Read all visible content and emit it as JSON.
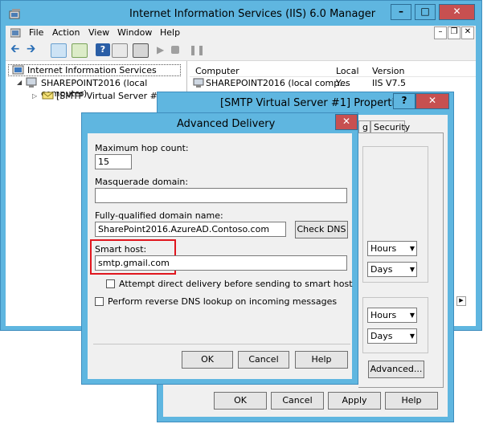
{
  "iis": {
    "title": "Internet Information Services (IIS) 6.0 Manager",
    "menu": [
      "File",
      "Action",
      "View",
      "Window",
      "Help"
    ],
    "tree": {
      "root": "Internet Information Services",
      "computer": "SHAREPOINT2016 (local computer)",
      "server": "[SMTP Virtual Server #1]"
    },
    "list": {
      "columns": [
        "Computer",
        "Local",
        "Version"
      ],
      "rows": [
        {
          "computer": "SHAREPOINT2016 (local comp...",
          "local": "Yes",
          "version": "IIS V7.5"
        }
      ]
    }
  },
  "properties": {
    "title": "[SMTP Virtual Server #1] Properties",
    "help_glyph": "?",
    "tabs": [
      "g",
      "Security"
    ],
    "dropdowns": [
      "Hours",
      "Days",
      "Hours",
      "Days"
    ],
    "advanced_button": "Advanced...",
    "buttons": {
      "ok": "OK",
      "cancel": "Cancel",
      "apply": "Apply",
      "help": "Help"
    }
  },
  "advanced": {
    "title": "Advanced Delivery",
    "max_hop_label": "Maximum hop count:",
    "max_hop_value": "15",
    "masquerade_label": "Masquerade domain:",
    "masquerade_value": "",
    "fqdn_label": "Fully-qualified domain name:",
    "fqdn_value": "SharePoint2016.AzureAD.Contoso.com",
    "check_dns": "Check DNS",
    "smart_host_label": "Smart host:",
    "smart_host_value": "smtp.gmail.com",
    "attempt_direct": "Attempt direct delivery before sending to smart host",
    "reverse_dns": "Perform reverse DNS lookup on incoming messages",
    "buttons": {
      "ok": "OK",
      "cancel": "Cancel",
      "help": "Help"
    }
  },
  "highlight_color": "#e0161e"
}
